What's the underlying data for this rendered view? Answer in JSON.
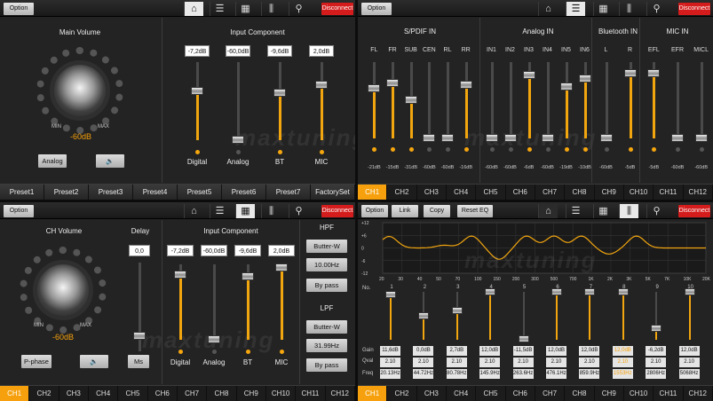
{
  "domain_note": "",
  "common": {
    "option": "Option",
    "disconnect": "Disconnect",
    "icons": [
      "home-icon",
      "sliders-icon",
      "grid-icon",
      "mixer-icon",
      "wrench-icon"
    ],
    "watermark": "maxtuning"
  },
  "q1": {
    "title": "Main Volume",
    "min": "MIN",
    "max": "MAX",
    "value": "-60dB",
    "analog_btn": "Analog",
    "input_title": "Input Component",
    "inputs": [
      {
        "name": "Digital",
        "value": "-7,2dB",
        "level": 0.62
      },
      {
        "name": "Analog",
        "value": "-60,0dB",
        "level": 0.0
      },
      {
        "name": "BT",
        "value": "-9,6dB",
        "level": 0.6
      },
      {
        "name": "MIC",
        "value": "2,0dB",
        "level": 0.7
      }
    ],
    "presets": [
      "Preset1",
      "Preset2",
      "Preset3",
      "Preset4",
      "Preset5",
      "Preset6",
      "Preset7",
      "FactorySet"
    ]
  },
  "q2": {
    "groups": [
      {
        "title": "S/PDIF IN",
        "ch": [
          "FL",
          "FR",
          "SUB",
          "CEN",
          "RL",
          "RR"
        ],
        "vals": [
          "-21dB",
          "-15dB",
          "-31dB",
          "-60dB",
          "-60dB",
          "-16dB"
        ],
        "lv": [
          0.65,
          0.72,
          0.5,
          0,
          0,
          0.7
        ]
      },
      {
        "title": "Analog IN",
        "ch": [
          "IN1",
          "IN2",
          "IN3",
          "IN4",
          "IN5",
          "IN6"
        ],
        "vals": [
          "-60dB",
          "-60dB",
          "-6dB",
          "-60dB",
          "-19dB",
          "-10dB"
        ],
        "lv": [
          0,
          0,
          0.82,
          0,
          0.68,
          0.78
        ]
      },
      {
        "title": "Bluetooth IN",
        "ch": [
          "L",
          "R"
        ],
        "vals": [
          "-60dB",
          "-5dB"
        ],
        "lv": [
          0,
          0.85
        ]
      },
      {
        "title": "MIC IN",
        "ch": [
          "EFL",
          "EFR",
          "MICL"
        ],
        "vals": [
          "-5dB",
          "-60dB",
          "-60dB"
        ],
        "lv": [
          0.85,
          0,
          0
        ]
      }
    ],
    "channels": [
      "CH1",
      "CH2",
      "CH3",
      "CH4",
      "CH5",
      "CH6",
      "CH7",
      "CH8",
      "CH9",
      "CH10",
      "CH11",
      "CH12"
    ]
  },
  "q3": {
    "title": "CH Volume",
    "delay_title": "Delay",
    "delay_value": "0,0",
    "min": "MIN",
    "max": "MAX",
    "value": "-60dB",
    "pphase": "P-phase",
    "ms": "Ms",
    "input_title": "Input Component",
    "inputs": [
      {
        "name": "Digital",
        "value": "-7,2dB",
        "level": 0.86
      },
      {
        "name": "Analog",
        "value": "-60,0dB",
        "level": 0.0
      },
      {
        "name": "BT",
        "value": "-9,6dB",
        "level": 0.84
      },
      {
        "name": "MIC",
        "value": "2,0dB",
        "level": 0.95
      }
    ],
    "hpf": {
      "title": "HPF",
      "type": "Butter-W",
      "freq": "10.00Hz",
      "bypass": "By pass"
    },
    "lpf": {
      "title": "LPF",
      "type": "Butter-W",
      "freq": "31.99Hz",
      "bypass": "By pass"
    },
    "channels": [
      "CH1",
      "CH2",
      "CH3",
      "CH4",
      "CH5",
      "CH6",
      "CH7",
      "CH8",
      "CH9",
      "CH10",
      "CH11",
      "CH12"
    ]
  },
  "q4": {
    "buttons": [
      "Option",
      "Link",
      "Copy",
      "Reset EQ"
    ],
    "y_ticks": [
      "+12",
      "+6",
      "0",
      "-6",
      "-12"
    ],
    "x_ticks": [
      "20",
      "30",
      "40",
      "50",
      "70",
      "100",
      "150",
      "200",
      "300",
      "500",
      "700",
      "1K",
      "2K",
      "3K",
      "5K",
      "7K",
      "10K",
      "20K"
    ],
    "row_labels": {
      "no": "No.",
      "gain": "Gain",
      "qval": "Qval",
      "freq": "Freq"
    },
    "bands": [
      {
        "no": "1",
        "gain": "11,6dB",
        "q": "2.10",
        "freq": "20.13Hz",
        "lv": 0.95
      },
      {
        "no": "2",
        "gain": "0,0dB",
        "q": "2.10",
        "freq": "44.72Hz",
        "lv": 0.5
      },
      {
        "no": "3",
        "gain": "2,7dB",
        "q": "2.10",
        "freq": "80.78Hz",
        "lv": 0.62
      },
      {
        "no": "4",
        "gain": "12,0dB",
        "q": "2.10",
        "freq": "145.9Hz",
        "lv": 1.0
      },
      {
        "no": "5",
        "gain": "-11,5dB",
        "q": "2.10",
        "freq": "263.6Hz",
        "lv": 0.02
      },
      {
        "no": "6",
        "gain": "12,0dB",
        "q": "2.10",
        "freq": "476.1Hz",
        "lv": 1.0
      },
      {
        "no": "7",
        "gain": "12,0dB",
        "q": "2.10",
        "freq": "859.9Hz",
        "lv": 1.0
      },
      {
        "no": "8",
        "gain": "12,0dB",
        "q": "2.10",
        "freq": "1553Hz",
        "lv": 1.0
      },
      {
        "no": "9",
        "gain": "-6,2dB",
        "q": "2.10",
        "freq": "2806Hz",
        "lv": 0.25
      },
      {
        "no": "10",
        "gain": "12,0dB",
        "q": "2.10",
        "freq": "5068Hz",
        "lv": 1.0
      }
    ],
    "channels": [
      "CH1",
      "CH2",
      "CH3",
      "CH4",
      "CH5",
      "CH6",
      "CH7",
      "CH8",
      "CH9",
      "CH10",
      "CH11",
      "CH12"
    ]
  }
}
